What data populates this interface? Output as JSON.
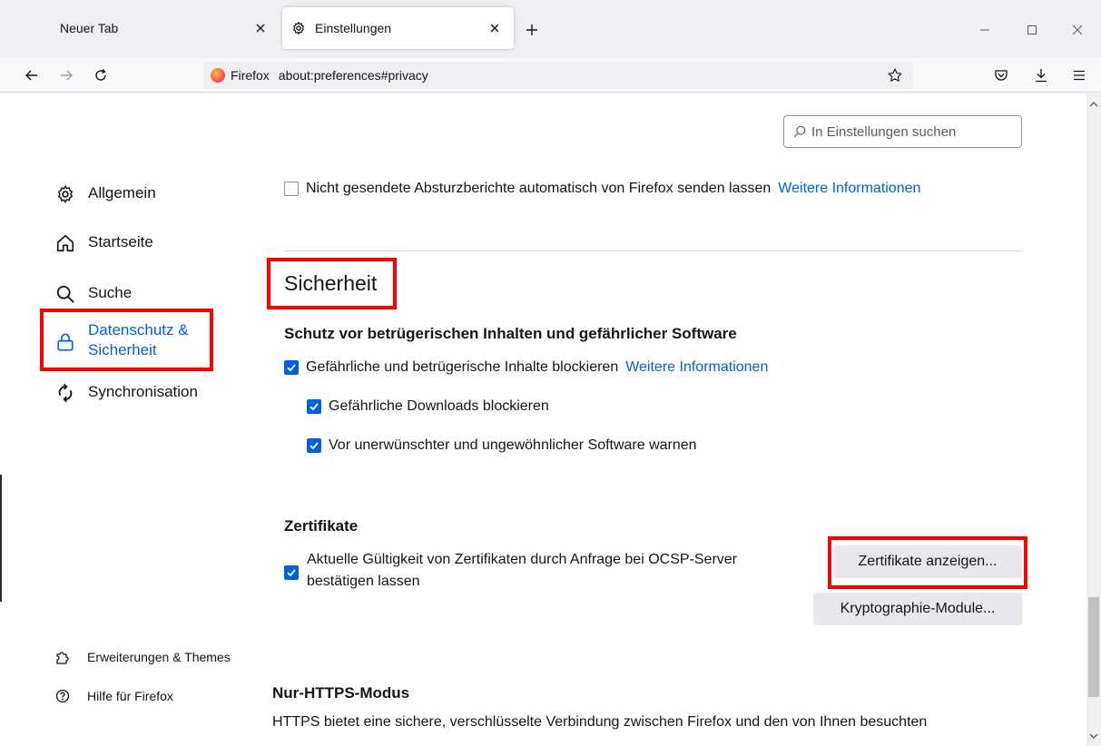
{
  "tabs": [
    {
      "title": "Neuer Tab",
      "active": false
    },
    {
      "title": "Einstellungen",
      "active": true
    }
  ],
  "navbar": {
    "identity_label": "Firefox",
    "url": "about:preferences#privacy"
  },
  "search": {
    "placeholder": "In Einstellungen suchen"
  },
  "sidebar": {
    "items": [
      {
        "label": "Allgemein",
        "icon": "gear-icon"
      },
      {
        "label": "Startseite",
        "icon": "home-icon"
      },
      {
        "label": "Suche",
        "icon": "search-icon"
      },
      {
        "label_line1": "Datenschutz &",
        "label_line2": "Sicherheit",
        "icon": "lock-icon",
        "selected": true
      },
      {
        "label": "Synchronisation",
        "icon": "sync-icon"
      }
    ],
    "footer": [
      {
        "label": "Erweiterungen & Themes",
        "icon": "puzzle-icon"
      },
      {
        "label": "Hilfe für Firefox",
        "icon": "help-icon"
      }
    ]
  },
  "main": {
    "crash_reports": {
      "label": "Nicht gesendete Absturzberichte automatisch von Firefox senden lassen",
      "checked": false,
      "link": "Weitere Informationen"
    },
    "security_heading": "Sicherheit",
    "deceptive": {
      "heading": "Schutz vor betrügerischen Inhalten und gefährlicher Software",
      "block_dangerous": {
        "label": "Gefährliche und betrügerische Inhalte blockieren",
        "checked": true,
        "link": "Weitere Informationen"
      },
      "block_downloads": {
        "label": "Gefährliche Downloads blockieren",
        "checked": true
      },
      "warn_software": {
        "label": "Vor unerwünschter und ungewöhnlicher Software warnen",
        "checked": true
      }
    },
    "certificates": {
      "heading": "Zertifikate",
      "ocsp_line1": "Aktuelle Gültigkeit von Zertifikaten durch Anfrage bei OCSP-Server",
      "ocsp_line2": "bestätigen lassen",
      "ocsp_checked": true,
      "view_button": "Zertifikate anzeigen...",
      "crypto_button": "Kryptographie-Module..."
    },
    "https_only": {
      "heading": "Nur-HTTPS-Modus",
      "text": "HTTPS bietet eine sichere, verschlüsselte Verbindung zwischen Firefox und den von Ihnen besuchten"
    }
  },
  "colors": {
    "accent": "#0061e0",
    "highlight": "#ff0000"
  }
}
